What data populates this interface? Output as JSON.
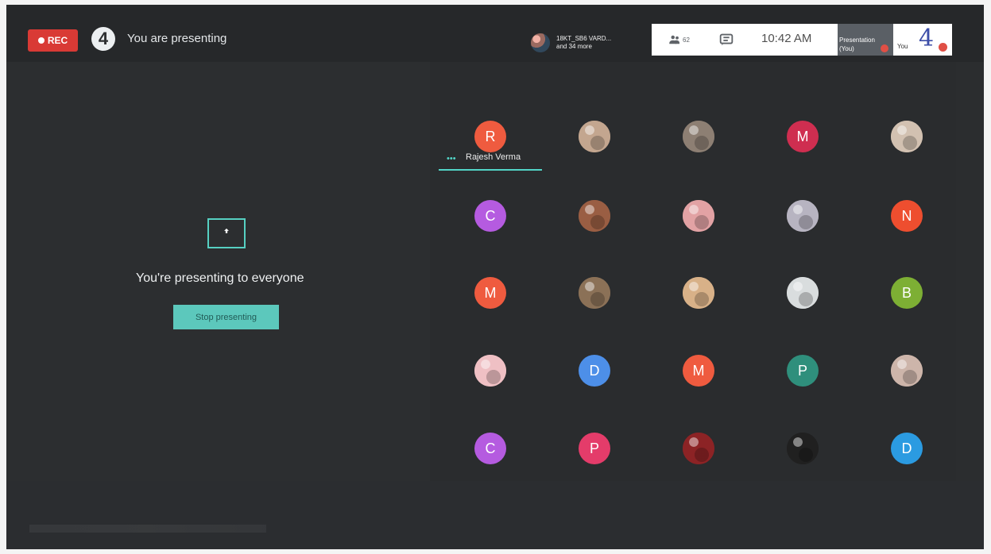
{
  "topbar": {
    "rec_label": "REC",
    "logo_glyph": "4",
    "presenting_title": "You are presenting",
    "participant_names": "18KT_SB6 VARD...",
    "participant_more": "and 34 more",
    "people_count": "62",
    "clock": "10:42 AM",
    "presentation_label_1": "Presentation",
    "presentation_label_2": "(You)",
    "you_label": "You",
    "you_badge": "4"
  },
  "presentation": {
    "message": "You're presenting to everyone",
    "stop_label": "Stop presenting"
  },
  "speaker": {
    "name": "Rajesh Verma",
    "indicator": "•••"
  },
  "grid": [
    {
      "type": "letter",
      "letter": "R",
      "color": "#ef5b3f"
    },
    {
      "type": "photo",
      "color": "#c3a68f"
    },
    {
      "type": "photo",
      "color": "#8d7f73"
    },
    {
      "type": "letter",
      "letter": "M",
      "color": "#cf2e50"
    },
    {
      "type": "photo",
      "color": "#d2c1b1"
    },
    {
      "type": "letter",
      "letter": "C",
      "color": "#b55be0"
    },
    {
      "type": "photo",
      "color": "#9a5e43"
    },
    {
      "type": "photo",
      "color": "#e2a2a4"
    },
    {
      "type": "photo",
      "color": "#b7b4c1"
    },
    {
      "type": "letter",
      "letter": "N",
      "color": "#ee4e2f"
    },
    {
      "type": "letter",
      "letter": "M",
      "color": "#ef5b3f"
    },
    {
      "type": "photo",
      "color": "#8b7157"
    },
    {
      "type": "photo",
      "color": "#d8b188"
    },
    {
      "type": "photo",
      "color": "#d9ddde"
    },
    {
      "type": "letter",
      "letter": "B",
      "color": "#7daf34"
    },
    {
      "type": "photo",
      "color": "#efc0c4"
    },
    {
      "type": "letter",
      "letter": "D",
      "color": "#4d8fe8"
    },
    {
      "type": "letter",
      "letter": "M",
      "color": "#ef5b3f"
    },
    {
      "type": "letter",
      "letter": "P",
      "color": "#2f8f7c"
    },
    {
      "type": "photo",
      "color": "#cdb5aa"
    },
    {
      "type": "letter",
      "letter": "C",
      "color": "#b55be0"
    },
    {
      "type": "letter",
      "letter": "P",
      "color": "#e43c6a"
    },
    {
      "type": "photo",
      "color": "#8c2325"
    },
    {
      "type": "photo",
      "color": "#202020"
    },
    {
      "type": "letter",
      "letter": "D",
      "color": "#2b9be1"
    }
  ]
}
